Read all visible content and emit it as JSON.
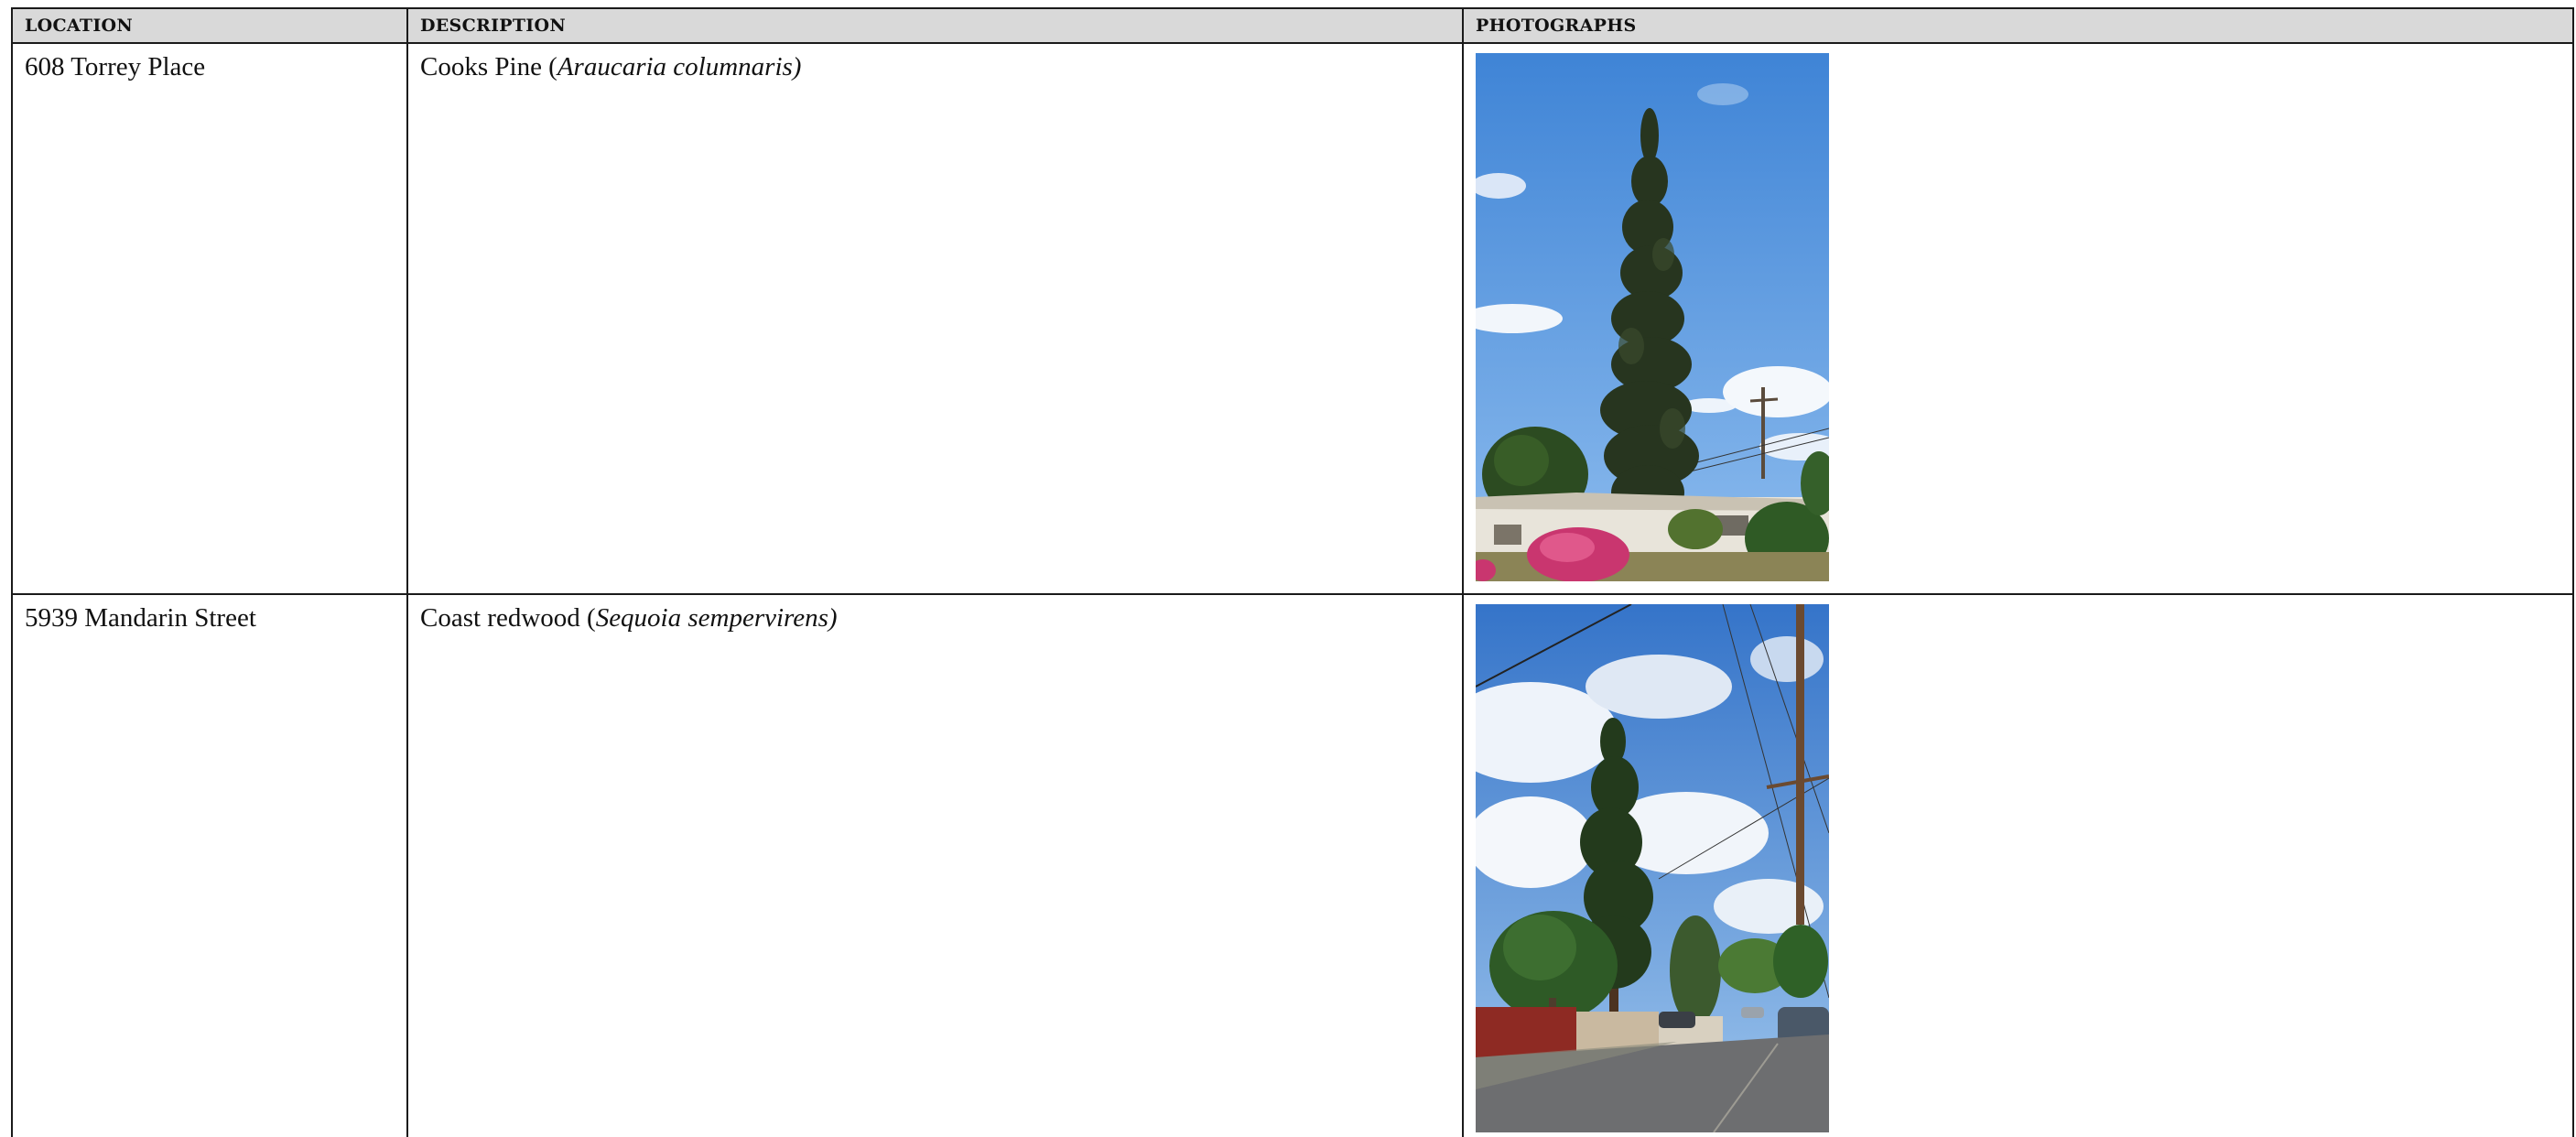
{
  "table": {
    "headers": {
      "location": "LOCATION",
      "description": "DESCRIPTION",
      "photographs": "PHOTOGRAPHS"
    },
    "rows": [
      {
        "location": "608 Torrey Place",
        "common_name": "Cooks Pine (",
        "scientific_name": "Araucaria columnaris)",
        "photo": "cooks-pine-photo"
      },
      {
        "location": "5939 Mandarin Street",
        "common_name": "Coast redwood (",
        "scientific_name": "Sequoia sempervirens)",
        "photo": "coast-redwood-photo"
      }
    ]
  },
  "colors": {
    "header_fill": "#d9d9d9",
    "grid_line": "#1a1a1a",
    "sky": "#4d8fd8"
  }
}
